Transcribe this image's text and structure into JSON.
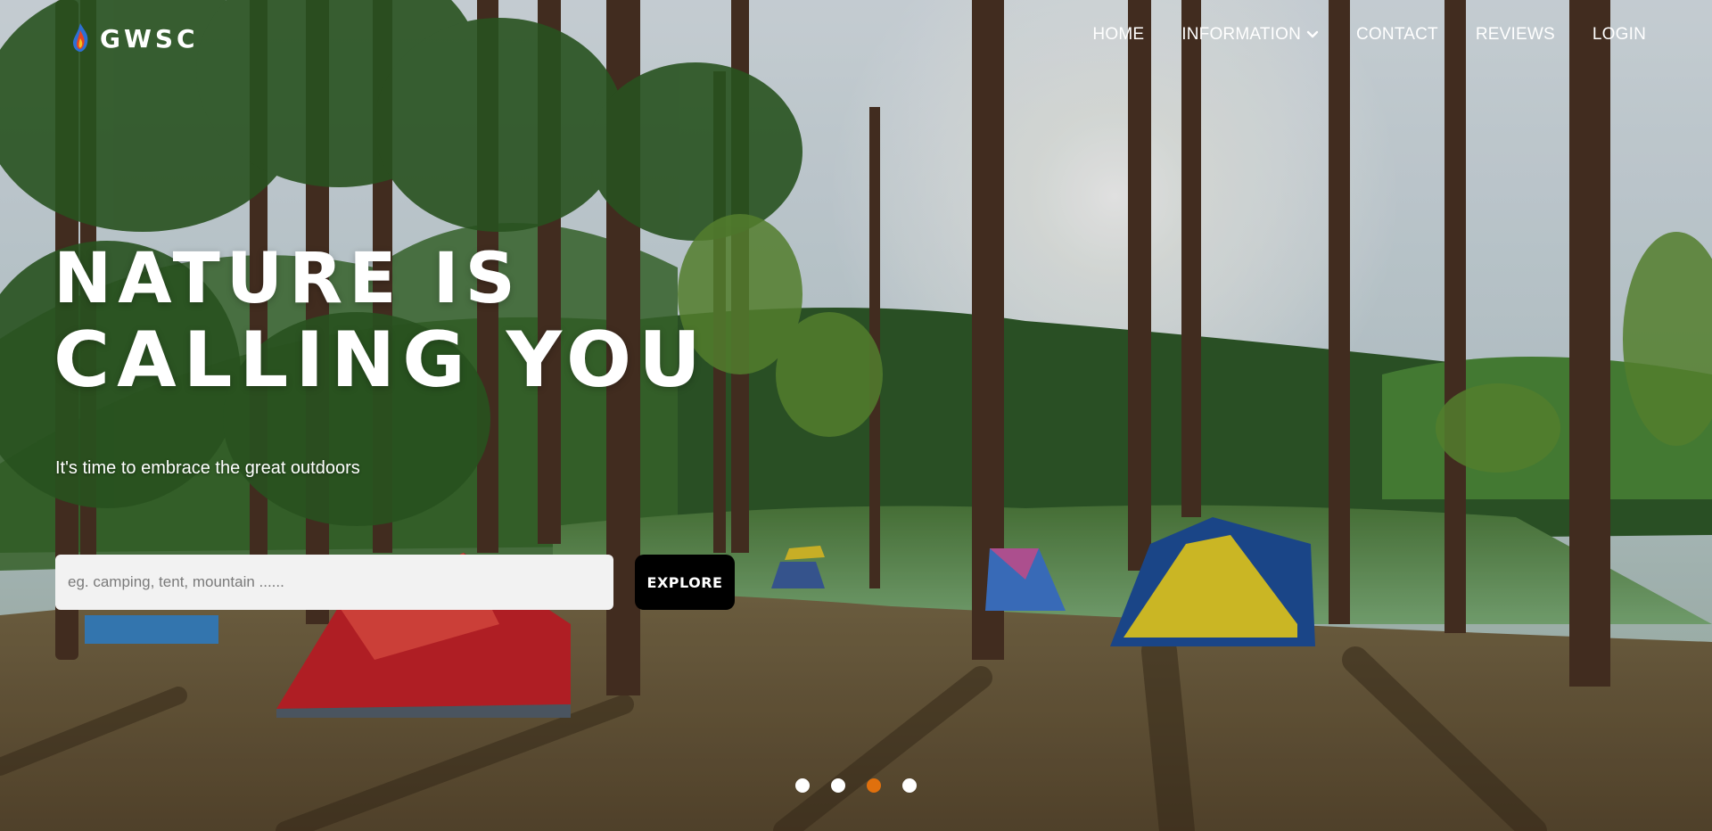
{
  "brand": {
    "name": "GWSC",
    "logo_icon": "campfire-logo-icon"
  },
  "nav": {
    "items": [
      {
        "label": "HOME"
      },
      {
        "label": "INFORMATION",
        "icon": "chevron-down-icon"
      },
      {
        "label": "CONTACT"
      },
      {
        "label": "REVIEWS"
      },
      {
        "label": "LOGIN"
      }
    ]
  },
  "hero": {
    "headline_line1": "NATURE IS",
    "headline_line2": "CALLING YOU",
    "tagline": "It's time to embrace the great outdoors",
    "search_placeholder": "eg. camping, tent, mountain ......",
    "search_value": "",
    "button_label": "EXPLORE"
  },
  "carousel": {
    "slides": 4,
    "active_index": 2
  },
  "colors": {
    "accent": "#e0700d",
    "button": "#000000",
    "text": "#ffffff"
  }
}
